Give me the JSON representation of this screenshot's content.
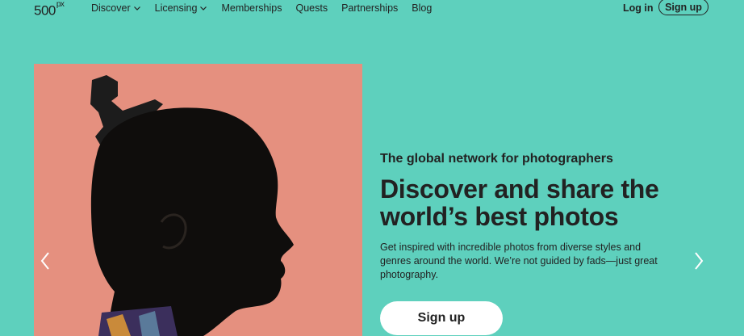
{
  "nav": {
    "logo_main": "500",
    "logo_sup": "px",
    "links": [
      {
        "label": "Discover",
        "icon": "chevron-down-icon"
      },
      {
        "label": "Licensing",
        "icon": "chevron-down-icon"
      },
      {
        "label": "Memberships"
      },
      {
        "label": "Quests"
      },
      {
        "label": "Partnerships"
      },
      {
        "label": "Blog"
      }
    ],
    "login": "Log in",
    "signup": "Sign up"
  },
  "hero": {
    "tagline": "The global network for photographers",
    "headline_line1": "Discover and share the",
    "headline_line2": "world’s best photos",
    "description": "Get inspired with incredible photos from diverse styles and genres around the world. We’re not guided by fads—just great photography.",
    "cta": "Sign up"
  },
  "carousel": {
    "prev_icon": "chevron-left-icon",
    "next_icon": "chevron-right-icon"
  },
  "colors": {
    "background": "#5ed0bd",
    "photo_background": "#e5907f",
    "text": "#222222",
    "button": "#ffffff"
  }
}
